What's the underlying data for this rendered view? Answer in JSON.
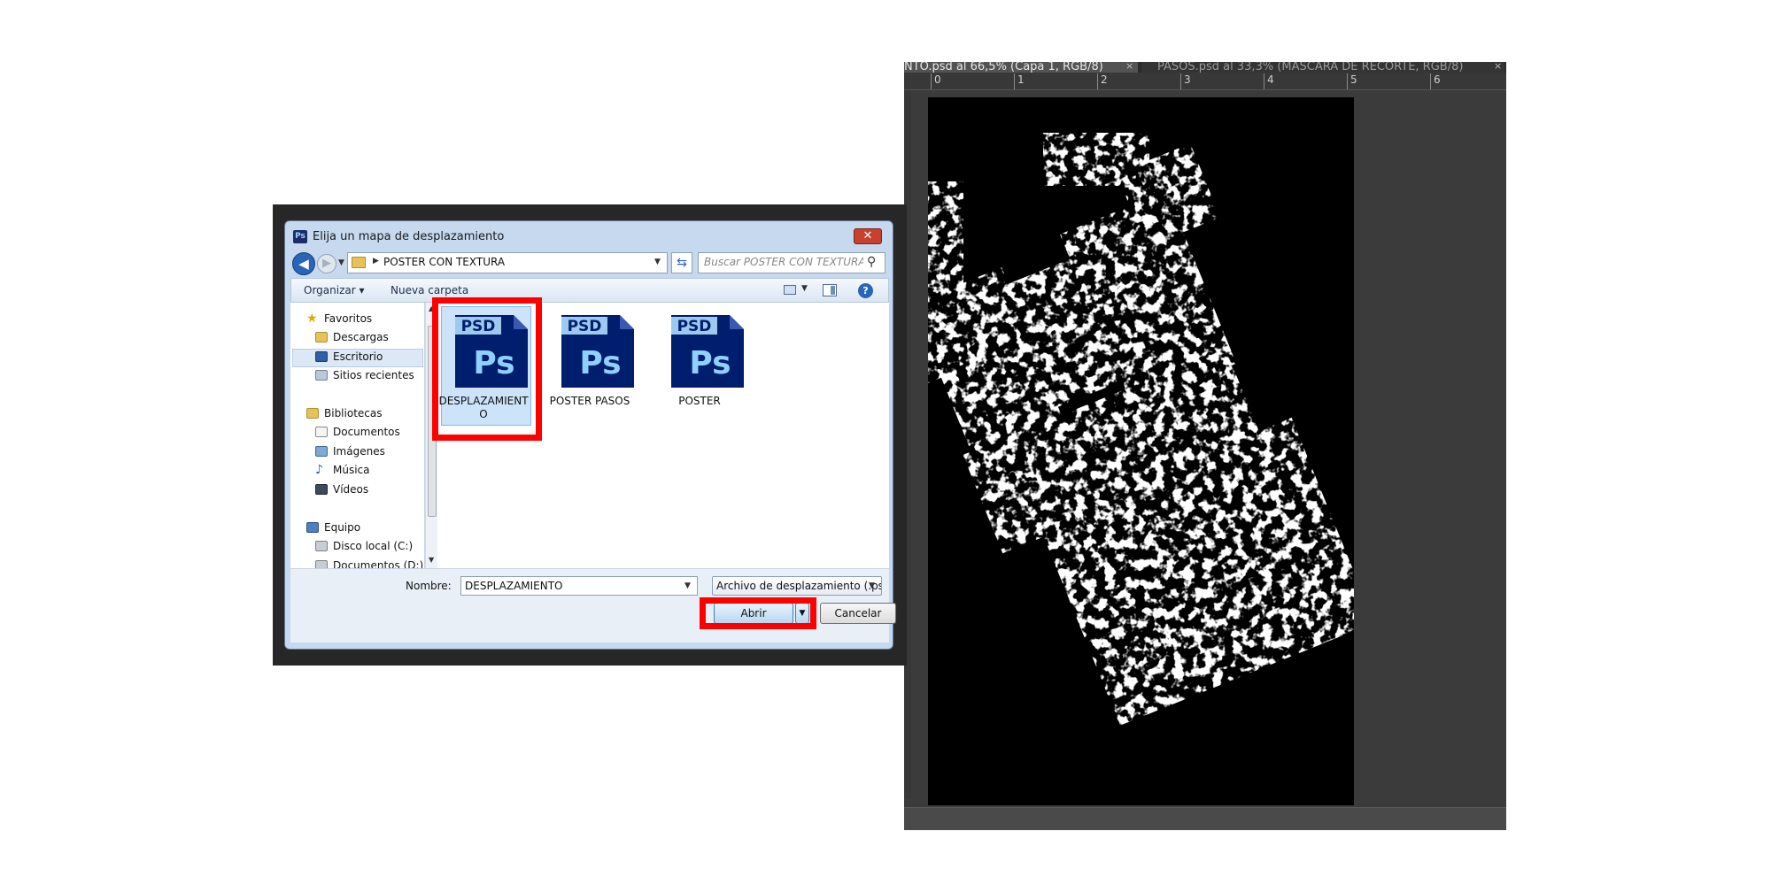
{
  "photoshop": {
    "tabs": [
      {
        "label": "NTO.psd al 66,5% (Capa 1, RGB/8)",
        "active": true
      },
      {
        "label": "PASOS.psd al 33,3% (MÁSCARA DE RECORTE, RGB/8)",
        "active": false
      }
    ],
    "close_glyph": "×",
    "ruler": [
      "0",
      "1",
      "2",
      "3",
      "4",
      "5",
      "6"
    ],
    "canvas_colors": {
      "background": "#000000",
      "texture": "#ffffff"
    }
  },
  "dialog": {
    "title": "Elija un mapa de desplazamiento",
    "app_icon_text": "Ps",
    "close_glyph": "✕",
    "address": "POSTER CON TEXTURA",
    "search_placeholder": "Buscar POSTER CON TEXTURA",
    "toolbar": {
      "organize_label": "Organizar ▾",
      "new_folder_label": "Nueva carpeta"
    },
    "nav": {
      "favorites": "Favoritos",
      "downloads": "Descargas",
      "desktop": "Escritorio",
      "recent": "Sitios recientes",
      "libraries": "Bibliotecas",
      "documents": "Documentos",
      "images": "Imágenes",
      "music": "Música",
      "videos": "Vídeos",
      "computer": "Equipo",
      "local_disk": "Disco local (C:)",
      "documents_d": "Documentos (D:)"
    },
    "files": [
      {
        "name": "DESPLAZAMIENTO",
        "selected": true
      },
      {
        "name": "POSTER PASOS",
        "selected": false
      },
      {
        "name": "POSTER",
        "selected": false
      }
    ],
    "file_icon": {
      "badge": "PSD",
      "logo": "Ps",
      "color": "#001d6e",
      "logo_color": "#8fd0ff"
    },
    "bottom": {
      "name_label": "Nombre:",
      "name_value": "DESPLAZAMIENTO",
      "type_value": "Archivo de desplazamiento (.ps",
      "open_label": "Abrir",
      "cancel_label": "Cancelar"
    },
    "highlight_color": "#ff0000"
  }
}
